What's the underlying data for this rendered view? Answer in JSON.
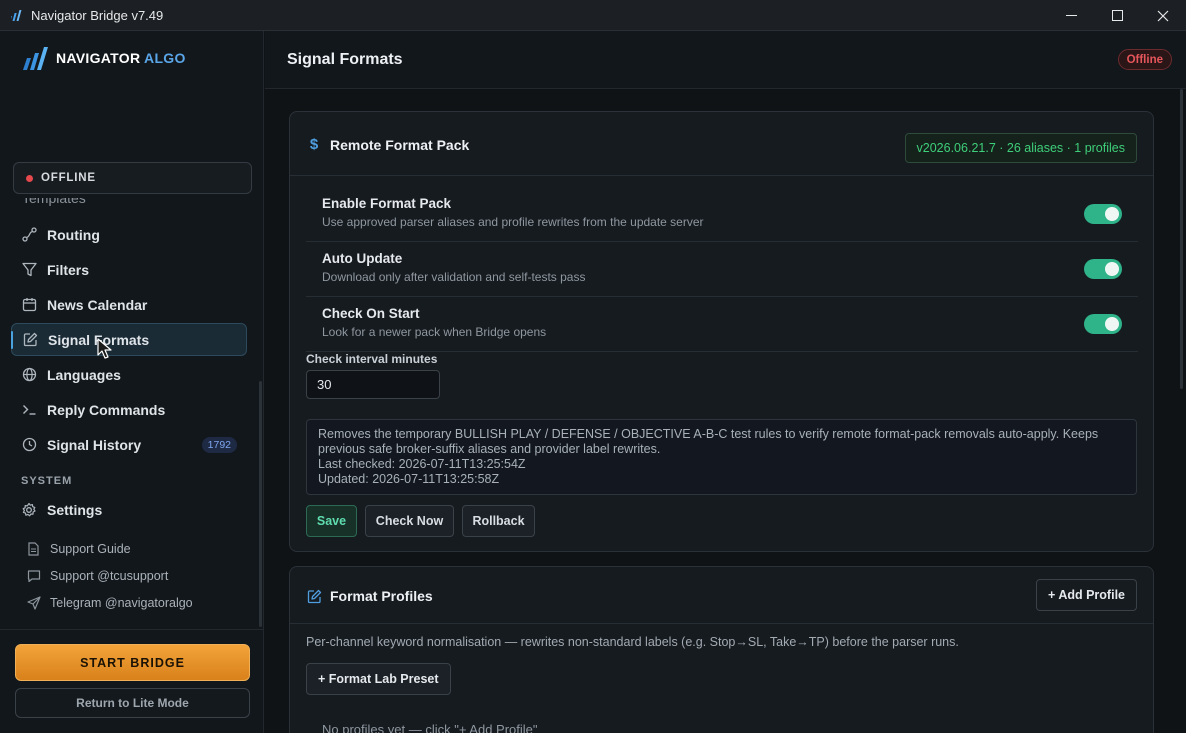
{
  "window": {
    "title": "Navigator Bridge v7.49"
  },
  "sidebar": {
    "logo": {
      "main": "NAVIGATOR",
      "accent": "ALGO"
    },
    "status": "OFFLINE",
    "clipped_item": "Templates",
    "items": [
      {
        "label": "Routing",
        "icon": "routing-icon"
      },
      {
        "label": "Filters",
        "icon": "filter-icon"
      },
      {
        "label": "News Calendar",
        "icon": "calendar-icon"
      },
      {
        "label": "Signal Formats",
        "icon": "edit-icon",
        "active": true
      },
      {
        "label": "Languages",
        "icon": "globe-icon"
      },
      {
        "label": "Reply Commands",
        "icon": "terminal-icon"
      },
      {
        "label": "Signal History",
        "icon": "clock-icon",
        "badge": "1792"
      }
    ],
    "system_label": "SYSTEM",
    "settings_label": "Settings",
    "links": [
      {
        "label": "Support Guide",
        "icon": "document-icon"
      },
      {
        "label": "Support @tcusupport",
        "icon": "chat-icon"
      },
      {
        "label": "Telegram @navigatoralgo",
        "icon": "send-icon"
      }
    ],
    "start_button": "START BRIDGE",
    "lite_button": "Return to Lite Mode"
  },
  "header": {
    "title": "Signal Formats",
    "status_badge": "Offline"
  },
  "format_pack": {
    "title": "Remote Format Pack",
    "version_tag": "v2026.06.21.7 · 26 aliases · 1 profiles",
    "toggles": [
      {
        "title": "Enable Format Pack",
        "desc": "Use approved parser aliases and profile rewrites from the update server",
        "on": true
      },
      {
        "title": "Auto Update",
        "desc": "Download only after validation and self-tests pass",
        "on": true
      },
      {
        "title": "Check On Start",
        "desc": "Look for a newer pack when Bridge opens",
        "on": true
      }
    ],
    "interval_label": "Check interval minutes",
    "interval_value": "30",
    "notes": {
      "line1": "Removes the temporary BULLISH PLAY / DEFENSE / OBJECTIVE A-B-C test rules to verify remote format-pack removals auto-apply. Keeps previous safe broker-suffix aliases and provider label rewrites.",
      "last_checked": "Last checked: 2026-07-11T13:25:54Z",
      "updated": "Updated: 2026-07-11T13:25:58Z"
    },
    "buttons": {
      "save": "Save",
      "check_now": "Check Now",
      "rollback": "Rollback"
    }
  },
  "format_profiles": {
    "title": "Format Profiles",
    "add_button": "+ Add Profile",
    "description": "Per-channel keyword normalisation — rewrites non-standard labels (e.g. Stop→SL, Take→TP) before the parser runs.",
    "preset_button": "+ Format Lab Preset",
    "empty_text": "No profiles yet — click \"+ Add Profile\""
  },
  "colors": {
    "accent": "#4aa3df",
    "toggle_on": "#2fb389",
    "start_button": "#e8921f",
    "offline": "#e5484d",
    "version_green": "#3ecf7a"
  }
}
